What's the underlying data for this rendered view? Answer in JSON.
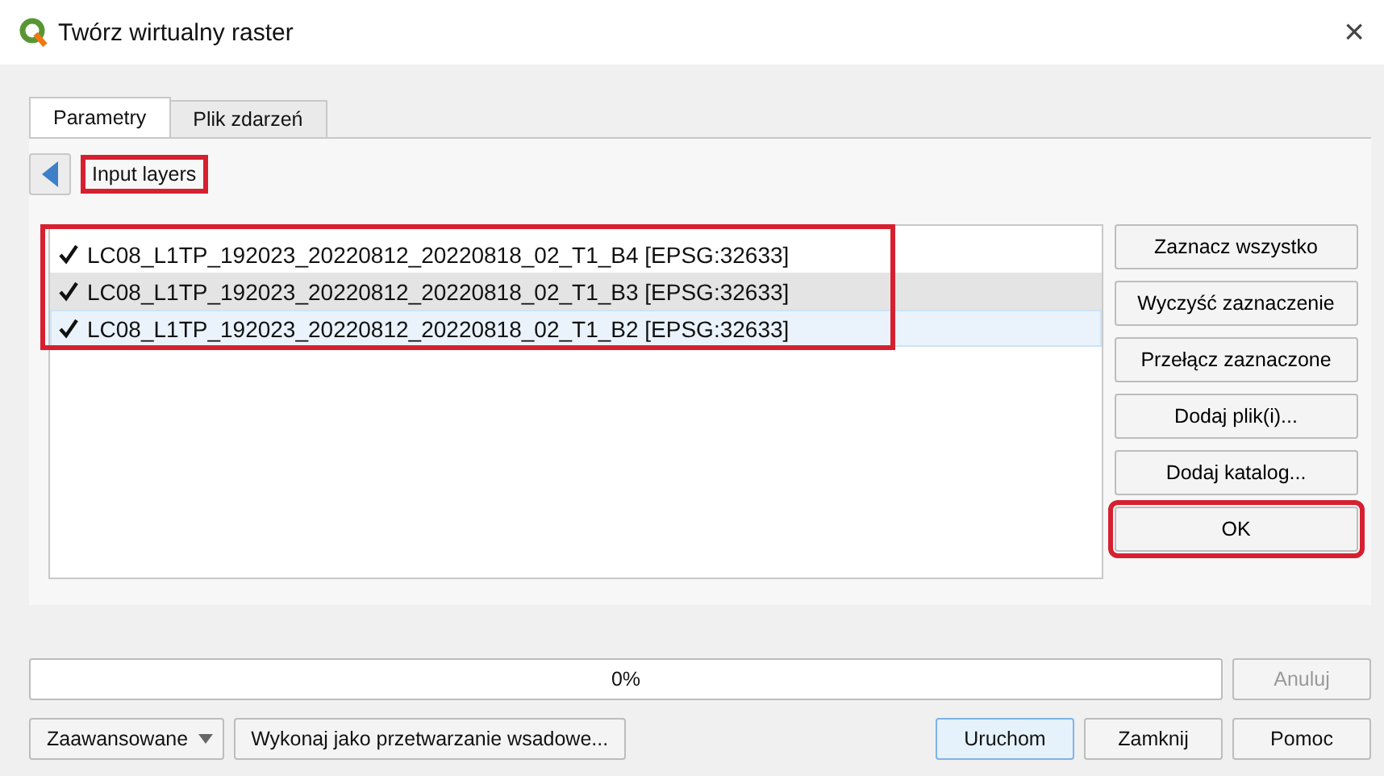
{
  "window": {
    "title": "Twórz wirtualny raster",
    "close": "×"
  },
  "tabs": [
    {
      "label": "Parametry",
      "selected": true
    },
    {
      "label": "Plik zdarzeń",
      "selected": false
    }
  ],
  "section": {
    "label": "Input layers",
    "highlighted": true
  },
  "layers": {
    "highlighted": true,
    "items": [
      {
        "name": "LC08_L1TP_192023_20220812_20220818_02_T1_B4 [EPSG:32633]",
        "checked": true,
        "selected": false,
        "hovered": false
      },
      {
        "name": "LC08_L1TP_192023_20220812_20220818_02_T1_B3 [EPSG:32633]",
        "checked": true,
        "selected": false,
        "hovered": true
      },
      {
        "name": "LC08_L1TP_192023_20220812_20220818_02_T1_B2 [EPSG:32633]",
        "checked": true,
        "selected": true,
        "hovered": false
      }
    ]
  },
  "side_buttons": [
    {
      "label": "Zaznacz wszystko",
      "highlighted": false
    },
    {
      "label": "Wyczyść zaznaczenie",
      "highlighted": false
    },
    {
      "label": "Przełącz zaznaczone",
      "highlighted": false
    },
    {
      "label": "Dodaj plik(i)...",
      "highlighted": false
    },
    {
      "label": "Dodaj katalog...",
      "highlighted": false
    },
    {
      "label": "OK",
      "highlighted": true
    }
  ],
  "progress": {
    "level": 0,
    "reading": "0%"
  },
  "cancel": {
    "label": "Anuluj",
    "disabled": true
  },
  "footer": {
    "advanced": "Zaawansowane",
    "batch": "Wykonaj jako przetwarzanie wsadowe...",
    "buttons": [
      {
        "label": "Uruchom",
        "default": true
      },
      {
        "label": "Zamknij",
        "default": false
      },
      {
        "label": "Pomoc",
        "default": false
      }
    ]
  }
}
